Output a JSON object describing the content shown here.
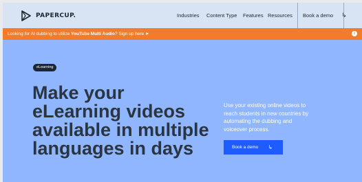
{
  "brand": {
    "name": "PAPERCUP."
  },
  "nav": {
    "links": [
      "Industries",
      "Content Type",
      "Features",
      "Resources"
    ],
    "cta_label": "Book a demo",
    "cta_arrow": "↳"
  },
  "banner": {
    "text_prefix": "Looking for AI dubbing to utilize ",
    "text_bold": "YouTube Multi Audio",
    "text_suffix": "? Sign up here ➤",
    "info_icon": "i"
  },
  "hero": {
    "tag": "eLearning",
    "headline": "Make your eLearning videos available in multiple languages in days",
    "lede": "Use your existing online videos to reach students in new countries by automating the dubbing and voiceover process.",
    "cta_label": "Book a demo",
    "cta_arrow": "↳"
  },
  "colors": {
    "background": "#8fb6ff",
    "nav_background": "#d8e4f3",
    "banner": "#f37b2a",
    "primary_button": "#1f5cff",
    "headline": "#2b3540"
  }
}
